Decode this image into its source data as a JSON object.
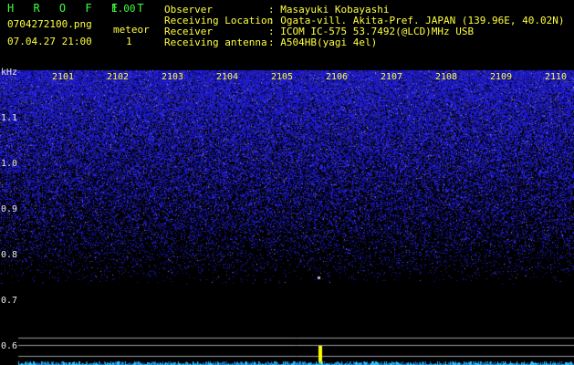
{
  "app": {
    "title": "H R O F F T",
    "version": "1.00",
    "filename": "0704272100.png",
    "datetime": "07.04.27 21:00",
    "mode_label": "meteor",
    "meteor_count": "1"
  },
  "info": {
    "rows": [
      {
        "label": "Observer",
        "value": ": Masayuki Kobayashi"
      },
      {
        "label": "Receiving Location",
        "value": ": Ogata-vill. Akita-Pref. JAPAN (139.96E, 40.02N)"
      },
      {
        "label": "Receiver",
        "value": ": ICOM IC-575 53.7492(@LCD)MHz USB"
      },
      {
        "label": "Receiving antenna",
        "value": ": A504HB(yagi 4el)"
      }
    ]
  },
  "spectrogram": {
    "y_unit": "kHz",
    "y_ticks": [
      "1.1",
      "1.0",
      "0.9",
      "0.8",
      "0.7",
      "0.6"
    ],
    "x_ticks": [
      "2101",
      "2102",
      "2103",
      "2104",
      "2105",
      "2106",
      "2107",
      "2108",
      "2109",
      "2110"
    ],
    "colors": {
      "title": "#40ff40",
      "info": "#ffff40",
      "white": "#ffffff",
      "noise": "#1a2aa8"
    }
  }
}
